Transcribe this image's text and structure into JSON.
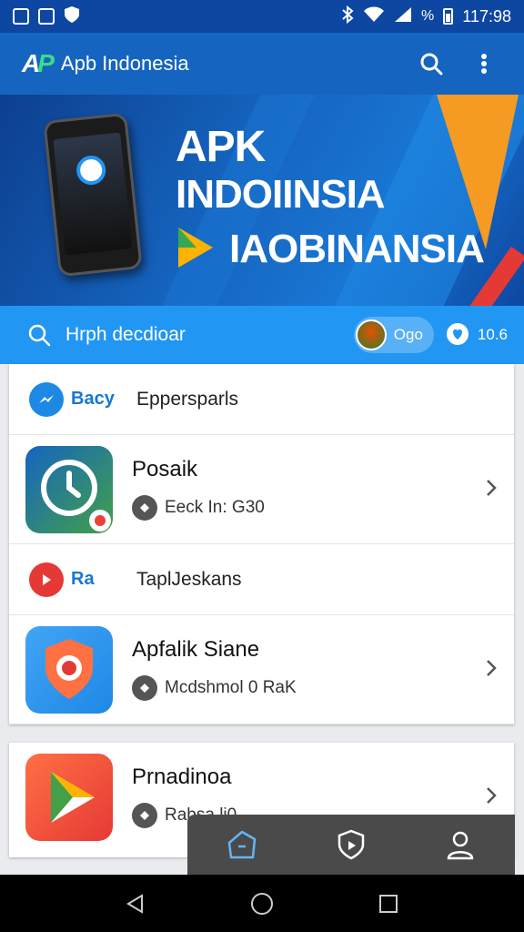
{
  "status_bar": {
    "time": "117:98",
    "signal_label": "%"
  },
  "app_bar": {
    "logo_a": "A",
    "logo_p": "P",
    "title": "Apb Indonesia"
  },
  "banner": {
    "line1": "APK",
    "line2": "INDOIINSIA",
    "line3": "IAOBINANSIA"
  },
  "search": {
    "text": "Hrph decdioar",
    "chip_label": "Ogo",
    "count": "10.6"
  },
  "list": {
    "rows": [
      {
        "type": "small",
        "brand": "Bacy",
        "label": "Eppersparls",
        "icon": "messenger-icon"
      },
      {
        "type": "app",
        "name": "Posaik",
        "meta": "Eeck In: G30",
        "icon": "clock-app-icon"
      },
      {
        "type": "small",
        "brand": "Ra",
        "label": "TaplJeskans",
        "icon": "play-circle-icon"
      },
      {
        "type": "app",
        "name": "Apfalik Siane",
        "meta": "Mcdshmol 0 RaK",
        "icon": "shield-app-icon"
      }
    ],
    "second_card": {
      "name": "Prnadinoa",
      "meta": "Rabsa li0",
      "icon": "play-store-icon"
    }
  },
  "colors": {
    "primary": "#1565c0",
    "accent": "#2196f3",
    "status": "#0d47a1"
  }
}
